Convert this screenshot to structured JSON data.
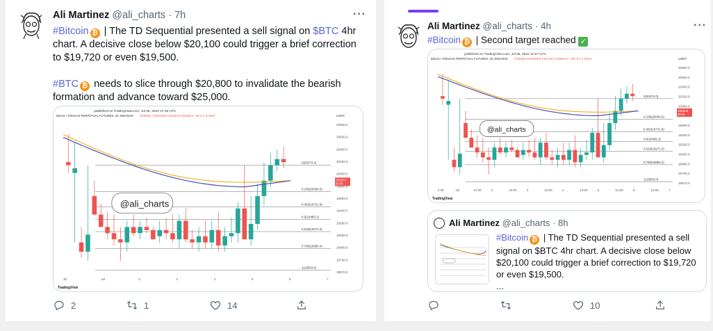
{
  "tweet1": {
    "name": "Ali Martinez",
    "handle": "@ali_charts",
    "time": "· 7h",
    "more": "···",
    "p1_tag": "#Bitcoin",
    "p1_a": "| The TD Sequential presented a sell signal on",
    "p1_ticker": "$BTC",
    "p1_b": "4hr chart. A decisive close below $20,100 could trigger a brief correction to $19,720 or even $19,500.",
    "p2_tag": "#BTC",
    "p2_text": "needs to slice through $20,800 to invalidate the bearish formation and advance toward $25,000.",
    "replies": "2",
    "retweets": "1",
    "likes": "14"
  },
  "tweet2": {
    "name": "Ali Martinez",
    "handle": "@ali_charts",
    "time": "· 4h",
    "more": "···",
    "tag": "#Bitcoin",
    "text": "| Second target reached",
    "quote": {
      "name": "Ali Martinez",
      "handle": "@ali_charts",
      "time": "· 8h",
      "tag": "#Bitcoin",
      "text": "| The TD Sequential presented a sell signal on $BTC 4hr chart. A decisive close below $20,100 could trigger a brief correction to $19,720 or even $19,500.",
      "ellipsis": "..."
    },
    "replies": "",
    "retweets": "",
    "likes": "10"
  },
  "chart1": {
    "published": "published on TradingView.com, Jul 05, 2022 07:29 UTC",
    "symbol": "Bitcoin / TetherUS PERPETUAL FUTURES, 4h, BINANCE",
    "ohlc": "O20302.7  H20448.6  L20187.9  C20235.3  −67.5 (−0.33%)",
    "currency": "USDT",
    "annotation": "@ali_charts",
    "watermark": "TradingView",
    "price_ticks": [
      "20800.0",
      "20600.0",
      "20400.0",
      "20200.0",
      "20000.0",
      "19800.0",
      "19600.0",
      "19400.0",
      "19200.0",
      "19050.0",
      "18900.0",
      "18730.0",
      "18570.0"
    ],
    "fib_labels": [
      "0(20474.0)",
      "0.236(20006.0)",
      "0.382(19721.8)",
      "0.5(19495.1)",
      "0.618(19271.0)",
      "0.786(18956.4)",
      "1(18563.0)"
    ],
    "time_ticks": [
      "30",
      "Jul",
      "2",
      "3",
      "4",
      "5",
      "6",
      "7"
    ],
    "price_tag": [
      "20235.3",
      "00:30"
    ]
  },
  "chart2": {
    "published": "published on TradingView.com, Jul 05, 2022 11:57 UTC",
    "symbol": "Bitcoin / TetherUS PERPETUAL FUTURES, 4h, BINANCE",
    "ohlc": "O20255.9  H20335.5  L20175.0  C19815.6  −197.0 (−1.01%)",
    "currency": "USDT",
    "annotation": "@ali_charts",
    "watermark": "TradingView",
    "price_ticks": [
      "20800.0",
      "20600.0",
      "20400.0",
      "20200.0",
      "20000.0",
      "19800.0",
      "19600.0",
      "19400.0",
      "19200.0",
      "19050.0",
      "18900.0",
      "18730.0",
      "18570.0"
    ],
    "fib_labels": [
      "0(20474.0)",
      "0.236(20006.0)",
      "0.382(19721.8)",
      "0.5(19495.1)",
      "0.618(19271.0)",
      "0.786(18956.4)",
      "1(18563.0)"
    ],
    "time_ticks": [
      "2:00",
      "Jul",
      "12:00",
      "2",
      "12:00",
      "3",
      "12:00",
      "4",
      "12:00",
      "5",
      "12:00",
      "6",
      "12:00",
      "7"
    ],
    "price_tag": [
      "19815.6",
      "02:04"
    ]
  },
  "colors": {
    "link": "#1d9bf0",
    "hashtag": "#5a67d8",
    "bull": "#26a69a",
    "bear": "#ef5350",
    "ema_blue": "#3f51b5",
    "ema_orange": "#f4a300"
  }
}
